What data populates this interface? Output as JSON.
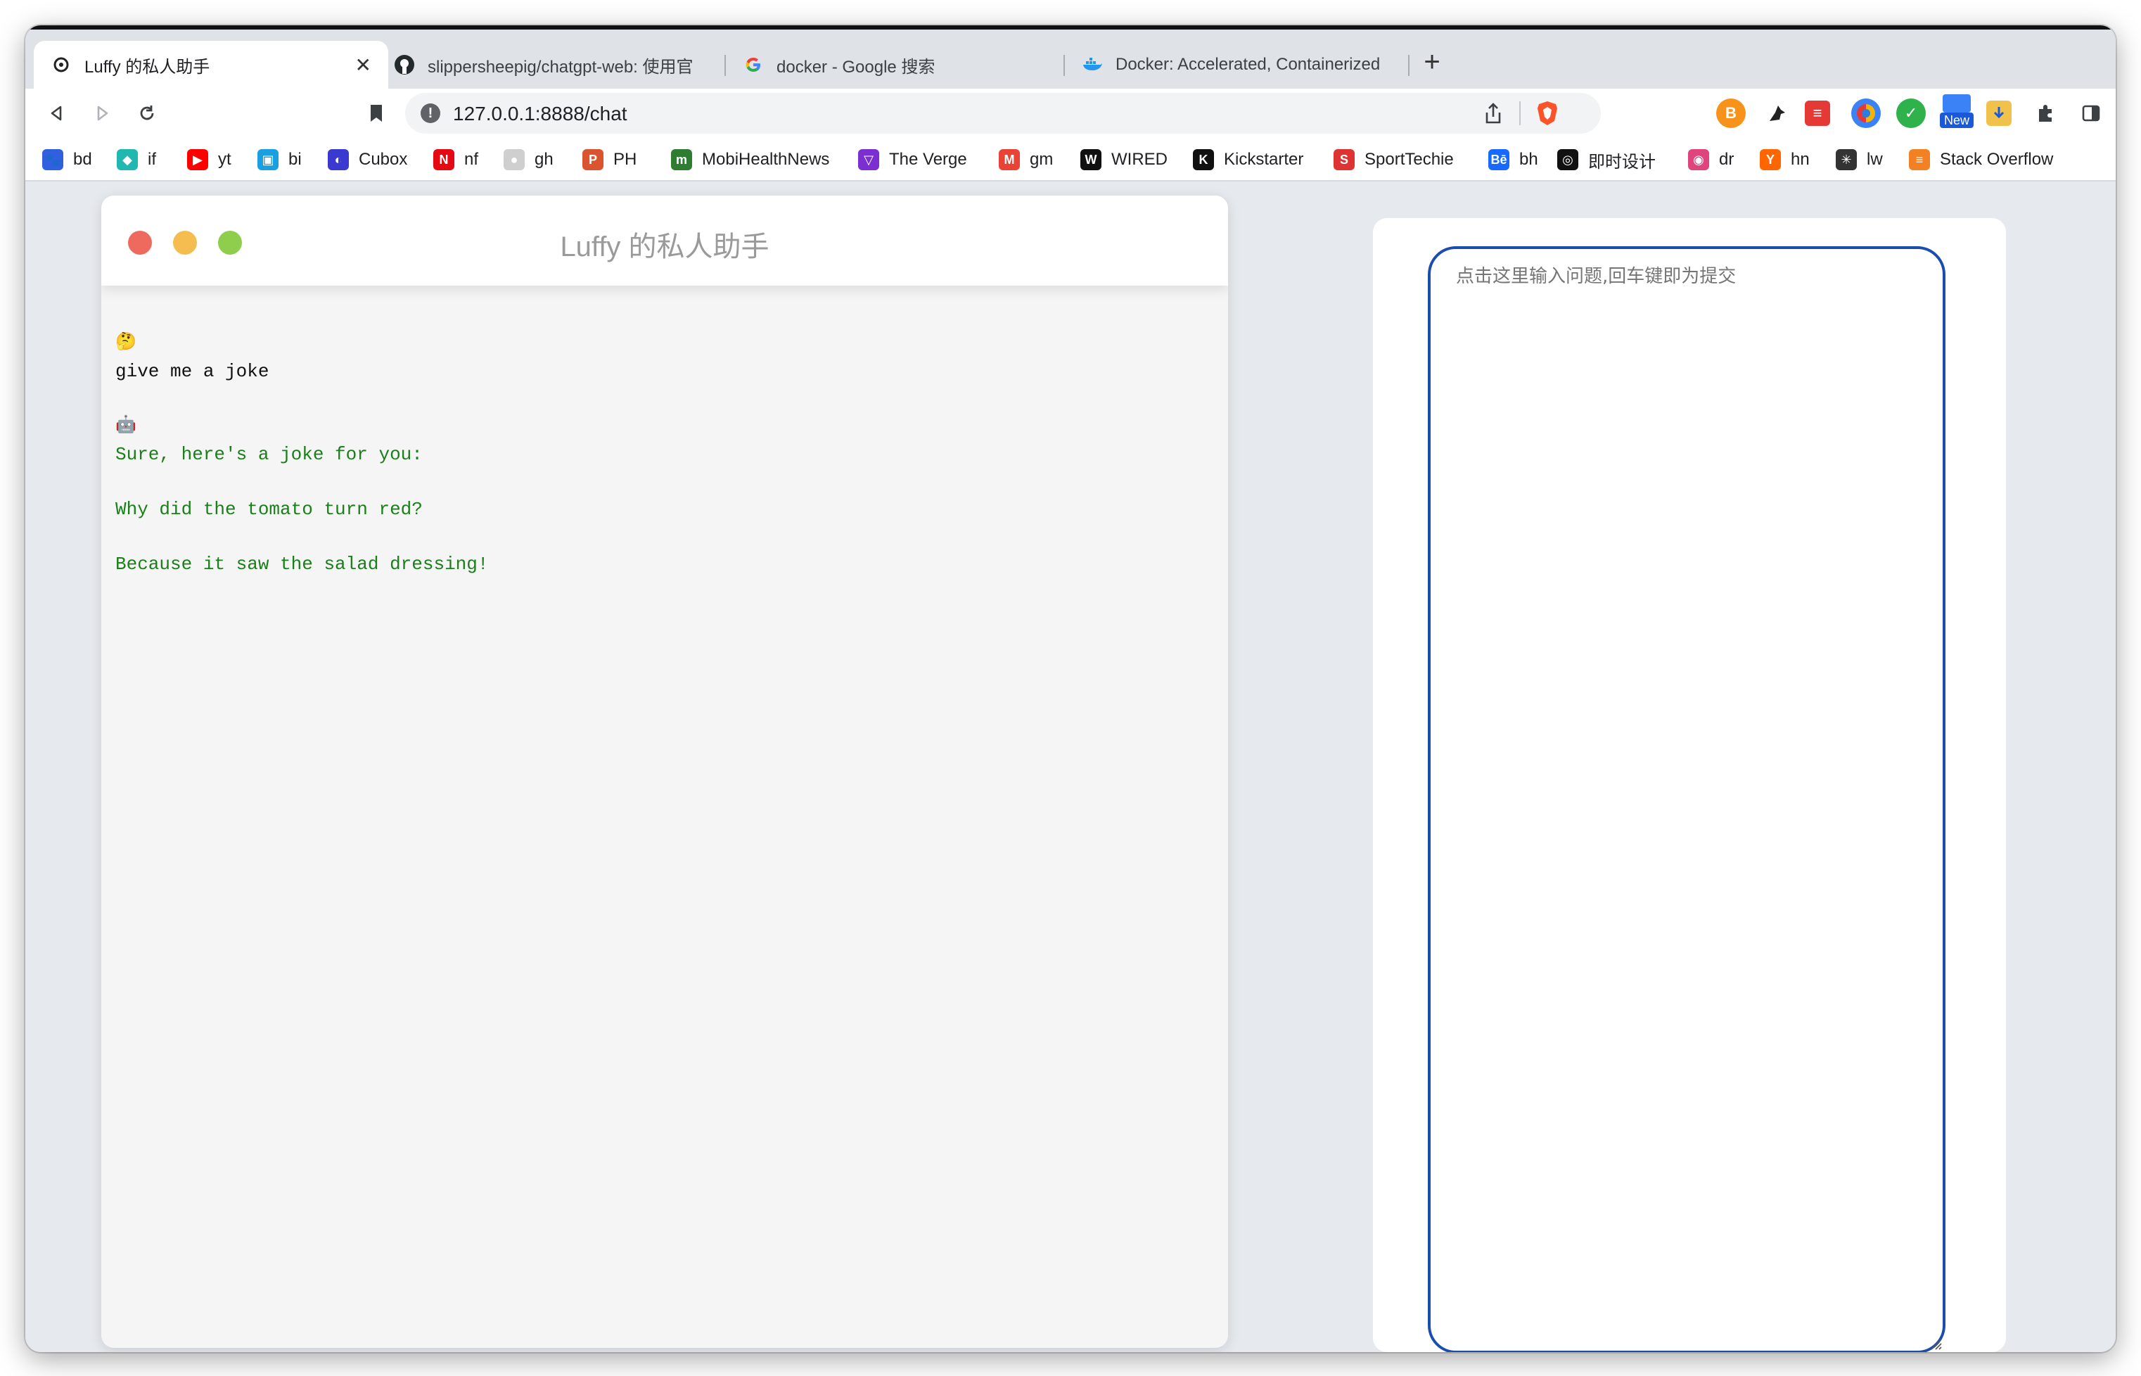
{
  "browser": {
    "tabs": [
      {
        "title": "Luffy 的私人助手",
        "icon": "openai-gear-icon",
        "active": true
      },
      {
        "title": "slippersheepig/chatgpt-web: 使用官",
        "icon": "github-icon"
      },
      {
        "title": "docker - Google 搜索",
        "icon": "google-icon"
      },
      {
        "title": "Docker: Accelerated, Containerized",
        "icon": "docker-icon"
      }
    ],
    "url": "127.0.0.1:8888/chat",
    "new_label": "New",
    "bookmarks": [
      {
        "label": "bd",
        "icon": "baidu-paw-icon",
        "color": "#3060e0"
      },
      {
        "label": "if",
        "icon": "ifanr-icon",
        "color": "#20b8b0"
      },
      {
        "label": "yt",
        "icon": "youtube-icon",
        "color": "#ff0000"
      },
      {
        "label": "bi",
        "icon": "bilibili-icon",
        "color": "#1aa0e0"
      },
      {
        "label": "Cubox",
        "icon": "cubox-icon",
        "color": "#3a3ad0"
      },
      {
        "label": "nf",
        "icon": "netflix-icon",
        "color": "#e50914"
      },
      {
        "label": "gh",
        "icon": "github-icon",
        "color": "#cfcfcf"
      },
      {
        "label": "PH",
        "icon": "producthunt-icon",
        "color": "#da552f"
      },
      {
        "label": "MobiHealthNews",
        "icon": "mobihealthnews-icon",
        "color": "#2e7d32"
      },
      {
        "label": "The Verge",
        "icon": "verge-icon",
        "color": "#7b2fd0"
      },
      {
        "label": "gm",
        "icon": "gmail-icon",
        "color": "#ea4335"
      },
      {
        "label": "WIRED",
        "icon": "wired-icon",
        "color": "#111111"
      },
      {
        "label": "Kickstarter",
        "icon": "kickstarter-icon",
        "color": "#111111"
      },
      {
        "label": "SportTechie",
        "icon": "sporttechie-icon",
        "color": "#d33"
      },
      {
        "label": "bh",
        "icon": "behance-icon",
        "color": "#1769ff"
      },
      {
        "label": "即时设计",
        "icon": "jishi-icon",
        "color": "#111111"
      },
      {
        "label": "dr",
        "icon": "dribbble-icon",
        "color": "#e0447c"
      },
      {
        "label": "hn",
        "icon": "hackernews-icon",
        "color": "#ff6600"
      },
      {
        "label": "lw",
        "icon": "lw-icon",
        "color": "#333333"
      },
      {
        "label": "Stack Overflow",
        "icon": "stackoverflow-icon",
        "color": "#f48024"
      }
    ]
  },
  "chat": {
    "title": "Luffy 的私人助手",
    "user_icon": "🤔",
    "user_message": "give me a joke",
    "bot_icon": "🤖",
    "bot_lines": [
      "Sure, here's a joke for you:",
      "Why did the tomato turn red?",
      "Because it saw the salad dressing!"
    ]
  },
  "input": {
    "placeholder": "点击这里输入问题,回车键即为提交"
  },
  "colors": {
    "bot_text": "#1a7f1a",
    "input_border": "#1a4db0",
    "traffic_red": "#ee6a5f",
    "traffic_yellow": "#f5bd4f",
    "traffic_green": "#8fce4d"
  }
}
